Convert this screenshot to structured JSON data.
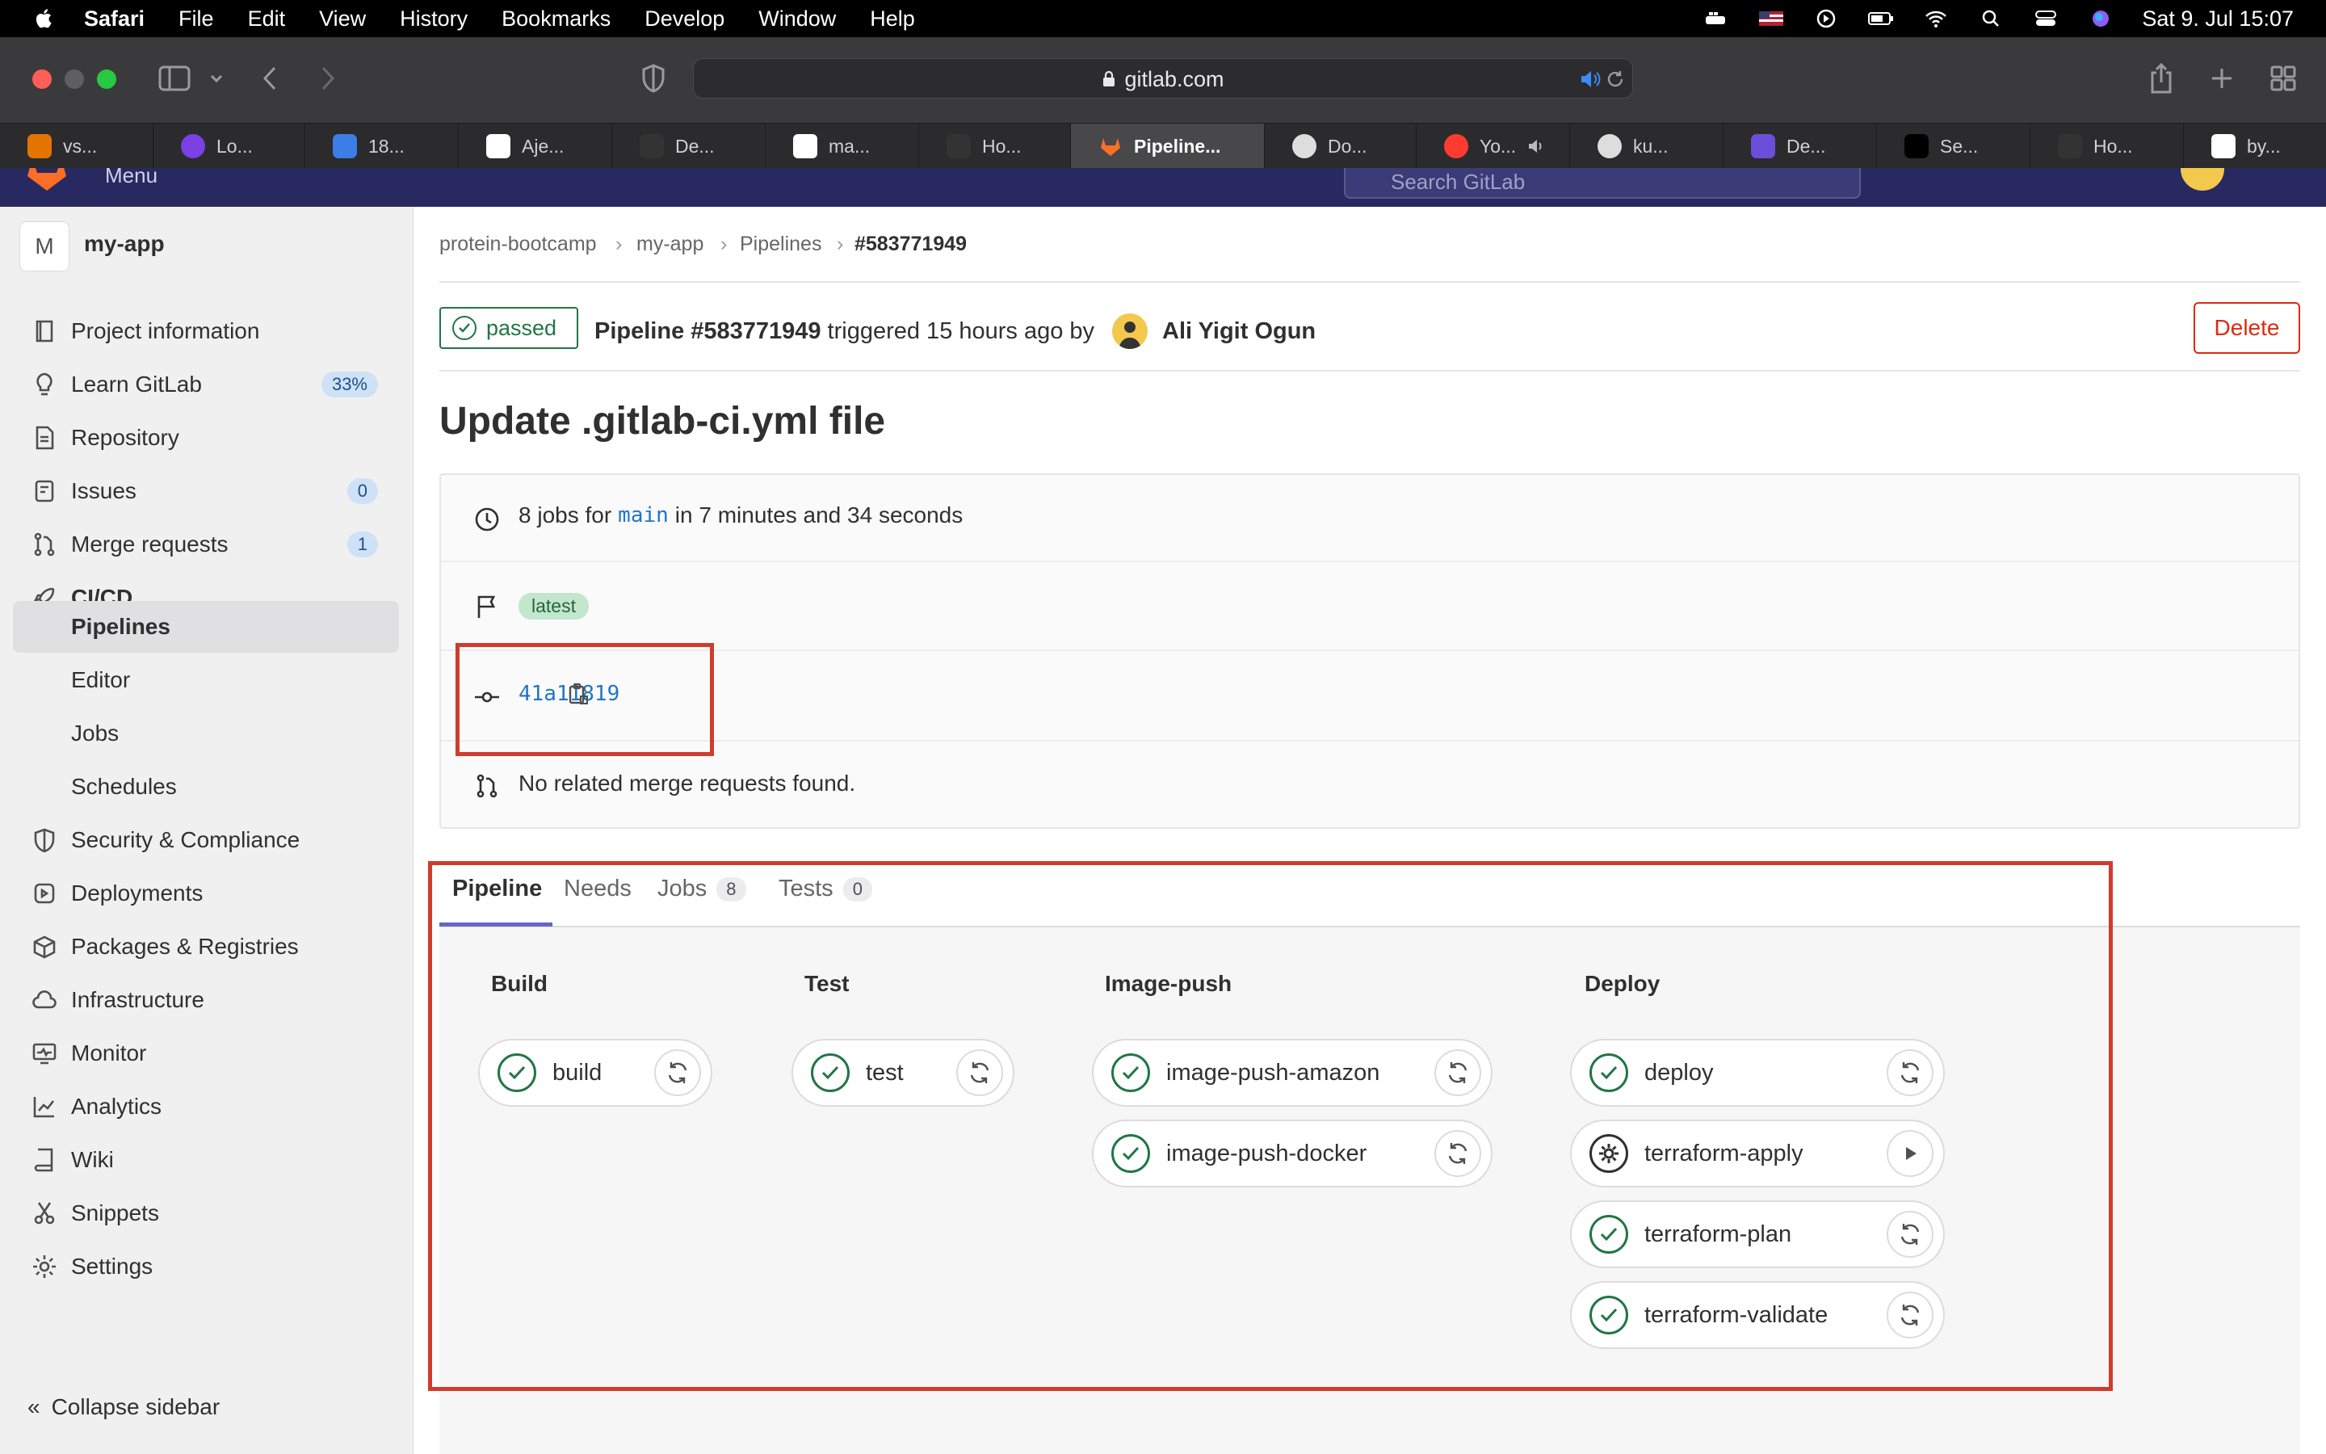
{
  "menubar": {
    "items": [
      "Safari",
      "File",
      "Edit",
      "View",
      "History",
      "Bookmarks",
      "Develop",
      "Window",
      "Help"
    ],
    "clock": "Sat 9. Jul  15:07"
  },
  "browser": {
    "url": "gitlab.com",
    "tabs": [
      {
        "label": "vs...",
        "color": "#e37400"
      },
      {
        "label": "Lo...",
        "color": "#7b3fe4"
      },
      {
        "label": "18...",
        "color": "#3d7de6"
      },
      {
        "label": "Aje...",
        "color": "#ffffff"
      },
      {
        "label": "De...",
        "color": "#333333"
      },
      {
        "label": "ma...",
        "color": "#ffffff"
      },
      {
        "label": "Ho...",
        "color": "#333333"
      },
      {
        "label": "Pipeline...",
        "color": "#fc6d26"
      },
      {
        "label": "Do...",
        "color": "#dddddd"
      },
      {
        "label": "Yo...",
        "color": "#ff3b30"
      },
      {
        "label": "ku...",
        "color": "#dddddd"
      },
      {
        "label": "De...",
        "color": "#6b4fd8"
      },
      {
        "label": "Se...",
        "color": "#000000"
      },
      {
        "label": "Ho...",
        "color": "#333333"
      },
      {
        "label": "by...",
        "color": "#ffffff"
      }
    ],
    "glbar": {
      "menu": "Menu",
      "search": "Search GitLab"
    }
  },
  "sidebar": {
    "avatar_letter": "M",
    "project": "my-app",
    "items": [
      {
        "label": "Project information",
        "icon": "info-icon"
      },
      {
        "label": "Learn GitLab",
        "icon": "bulb-icon",
        "badge": "33%"
      },
      {
        "label": "Repository",
        "icon": "doc-icon"
      },
      {
        "label": "Issues",
        "icon": "issues-icon",
        "badge": "0"
      },
      {
        "label": "Merge requests",
        "icon": "merge-icon",
        "badge": "1"
      },
      {
        "label": "CI/CD",
        "icon": "rocket-icon"
      },
      {
        "label": "Pipelines"
      },
      {
        "label": "Editor"
      },
      {
        "label": "Jobs"
      },
      {
        "label": "Schedules"
      },
      {
        "label": "Security & Compliance",
        "icon": "shield-icon"
      },
      {
        "label": "Deployments",
        "icon": "deploy-icon"
      },
      {
        "label": "Packages & Registries",
        "icon": "package-icon"
      },
      {
        "label": "Infrastructure",
        "icon": "cloud-icon"
      },
      {
        "label": "Monitor",
        "icon": "monitor-icon"
      },
      {
        "label": "Analytics",
        "icon": "chart-icon"
      },
      {
        "label": "Wiki",
        "icon": "book-icon"
      },
      {
        "label": "Snippets",
        "icon": "scissors-icon"
      },
      {
        "label": "Settings",
        "icon": "gear-icon"
      }
    ],
    "collapse": "Collapse sidebar"
  },
  "breadcrumb": [
    "protein-bootcamp",
    "my-app",
    "Pipelines",
    "#583771949"
  ],
  "header": {
    "status": "passed",
    "pipeline_label": "Pipeline #583771949",
    "triggered": "triggered 15 hours ago by",
    "user": "Ali Yigit Ogun",
    "delete": "Delete"
  },
  "title": "Update .gitlab-ci.yml file",
  "info": {
    "jobs_prefix": "8 jobs for",
    "branch": "main",
    "duration": "in 7 minutes and 34 seconds",
    "tag": "latest",
    "commit": "41a11819",
    "mr_text": "No related merge requests found."
  },
  "tabs": [
    {
      "label": "Pipeline"
    },
    {
      "label": "Needs"
    },
    {
      "label": "Jobs",
      "count": "8"
    },
    {
      "label": "Tests",
      "count": "0"
    }
  ],
  "stages": [
    {
      "name": "Build",
      "jobs": [
        {
          "name": "build",
          "status": "success",
          "action": "retry"
        }
      ]
    },
    {
      "name": "Test",
      "jobs": [
        {
          "name": "test",
          "status": "success",
          "action": "retry"
        }
      ]
    },
    {
      "name": "Image-push",
      "jobs": [
        {
          "name": "image-push-amazon",
          "status": "success",
          "action": "retry"
        },
        {
          "name": "image-push-docker",
          "status": "success",
          "action": "retry"
        }
      ]
    },
    {
      "name": "Deploy",
      "jobs": [
        {
          "name": "deploy",
          "status": "success",
          "action": "retry"
        },
        {
          "name": "terraform-apply",
          "status": "manual",
          "action": "play"
        },
        {
          "name": "terraform-plan",
          "status": "success",
          "action": "retry"
        },
        {
          "name": "terraform-validate",
          "status": "success",
          "action": "retry"
        }
      ]
    }
  ],
  "colors": {
    "success": "#217645",
    "danger": "#dd2b0e",
    "highlight": "#d03c2c",
    "tab_accent": "#6666c4"
  }
}
